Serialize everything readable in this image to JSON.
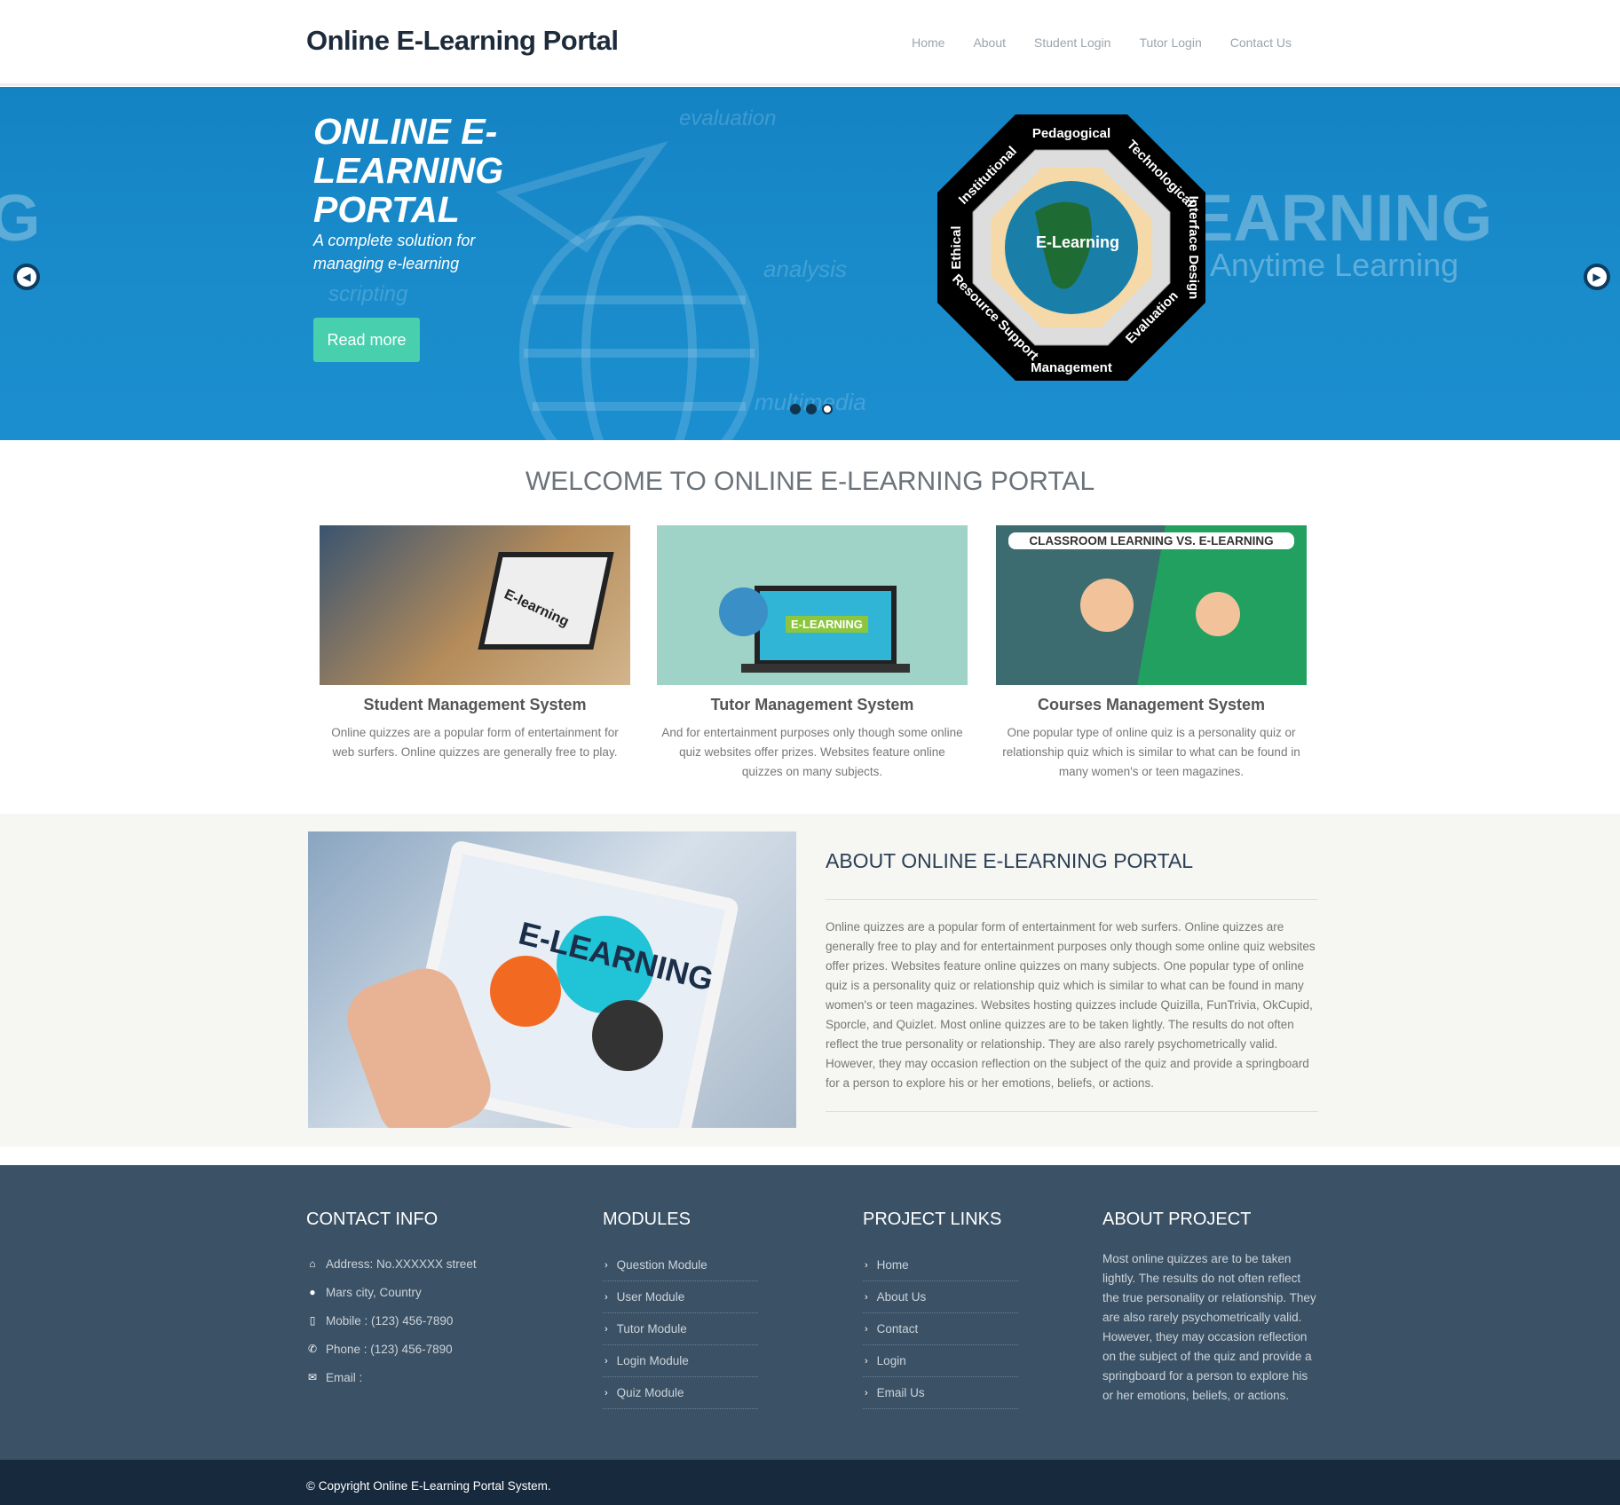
{
  "header": {
    "brand": "Online E-Learning Portal",
    "nav": [
      "Home",
      "About",
      "Student Login",
      "Tutor Login",
      "Contact Us"
    ]
  },
  "hero": {
    "title": "ONLINE E-LEARNING PORTAL",
    "subtitle": "A complete solution for managing e-learning",
    "button": "Read more",
    "slide_count": 3,
    "active_slide": 3,
    "background_words": [
      "evaluation",
      "analysis",
      "scripting",
      "multimedia",
      "EARNING",
      ", Anytime Learning"
    ],
    "diagram": {
      "center": "E-Learning",
      "labels": [
        "Pedagogical",
        "Technological",
        "Interface Design",
        "Evaluation",
        "Management",
        "Resource Support",
        "Ethical",
        "Institutional"
      ]
    }
  },
  "welcome": {
    "title": "WELCOME TO ONLINE E-LEARNING PORTAL"
  },
  "cards": [
    {
      "title": "Student Management System",
      "text": "Online quizzes are a popular form of entertainment for web surfers. Online quizzes are generally free to play.",
      "image_text": "E-learning"
    },
    {
      "title": "Tutor Management System",
      "text": "And for entertainment purposes only though some online quiz websites offer prizes. Websites feature online quizzes on many subjects.",
      "image_text": "E-LEARNING"
    },
    {
      "title": "Courses Management System",
      "text": "One popular type of online quiz is a personality quiz or relationship quiz which is similar to what can be found in many women's or teen magazines.",
      "image_text": "CLASSROOM LEARNING VS. E-LEARNING"
    }
  ],
  "about": {
    "title": "ABOUT ONLINE E-LEARNING PORTAL",
    "image_text": "E-LEARNING",
    "text": "Online quizzes are a popular form of entertainment for web surfers. Online quizzes are generally free to play and for entertainment purposes only though some online quiz websites offer prizes. Websites feature online quizzes on many subjects. One popular type of online quiz is a personality quiz or relationship quiz which is similar to what can be found in many women's or teen magazines. Websites hosting quizzes include Quizilla, FunTrivia, OkCupid, Sporcle, and Quizlet. Most online quizzes are to be taken lightly. The results do not often reflect the true personality or relationship. They are also rarely psychometrically valid. However, they may occasion reflection on the subject of the quiz and provide a springboard for a person to explore his or her emotions, beliefs, or actions."
  },
  "footer": {
    "contact": {
      "title": "CONTACT INFO",
      "items": [
        "Address: No.XXXXXX street",
        "Mars city, Country",
        "Mobile : (123) 456-7890",
        "Phone : (123) 456-7890",
        "Email :"
      ]
    },
    "modules": {
      "title": "MODULES",
      "items": [
        "Question Module",
        "User Module",
        "Tutor Module",
        "Login Module",
        "Quiz Module"
      ]
    },
    "links": {
      "title": "PROJECT LINKS",
      "items": [
        "Home",
        "About Us",
        "Contact",
        "Login",
        "Email Us"
      ]
    },
    "about": {
      "title": "ABOUT PROJECT",
      "text": "Most online quizzes are to be taken lightly. The results do not often reflect the true personality or relationship. They are also rarely psychometrically valid. However, they may occasion reflection on the subject of the quiz and provide a springboard for a person to explore his or her emotions, beliefs, or actions."
    },
    "copyright": "© Copyright Online E-Learning Portal System."
  },
  "colors": {
    "hero_bg": "#1a8ccb",
    "button": "#48cfad",
    "footer": "#3b5266",
    "bottom_bar": "#172a3d"
  }
}
